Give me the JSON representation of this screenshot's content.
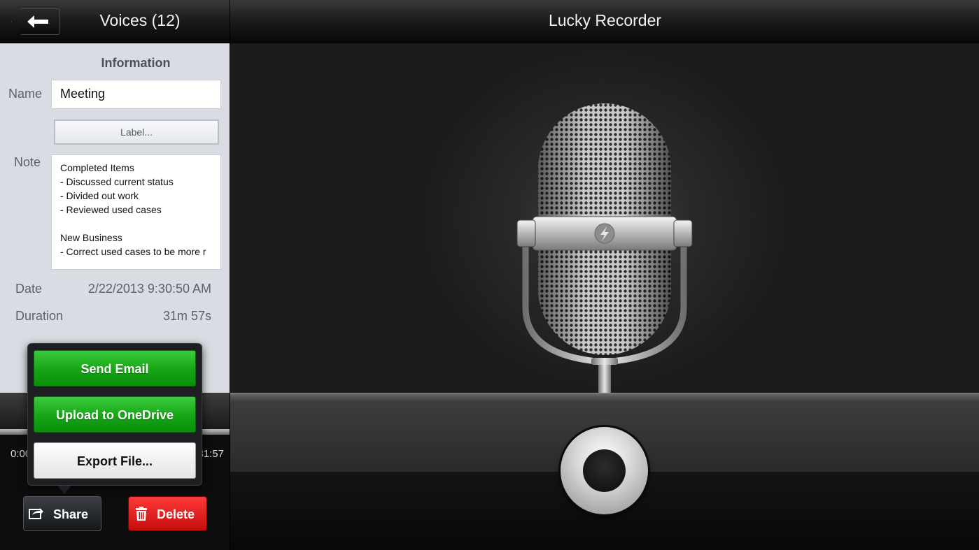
{
  "left_header": {
    "back_icon": "back-arrow-icon",
    "title": "Voices (12)"
  },
  "info": {
    "heading": "Information",
    "name_label": "Name",
    "name_value": "Meeting",
    "label_button": "Label...",
    "note_label": "Note",
    "note_lines": [
      "Completed Items",
      "- Discussed current status",
      "- Divided out work",
      "- Reviewed used cases",
      "",
      "New Business",
      "- Correct used cases to be more r"
    ],
    "date_label": "Date",
    "date_value": "2/22/2013 9:30:50 AM",
    "duration_label": "Duration",
    "duration_value": "31m 57s"
  },
  "playback": {
    "time_start": "0:00",
    "time_end": "31:57"
  },
  "share_menu": {
    "send_email": "Send Email",
    "upload_onedrive": "Upload to OneDrive",
    "export_file": "Export File..."
  },
  "actions": {
    "share_label": "Share",
    "share_icon": "share-icon",
    "delete_label": "Delete",
    "delete_icon": "trash-icon"
  },
  "right_header": {
    "title": "Lucky Recorder"
  },
  "colors": {
    "green": "#18a818",
    "red": "#e01b1b",
    "panel": "#d9dde3"
  }
}
